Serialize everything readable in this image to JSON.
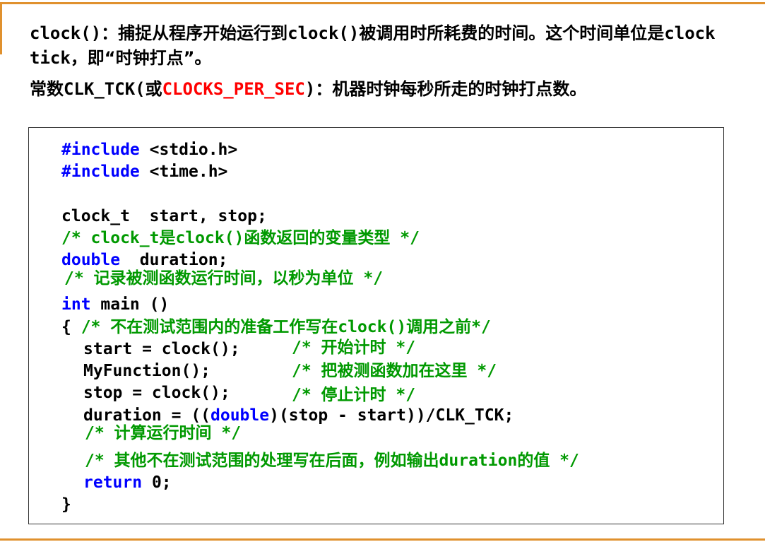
{
  "intro": {
    "line1_code": "clock()",
    "line1_text": "：捕捉从程序开始运行到",
    "line1_code2": "clock()",
    "line1_text2": "被调用时所耗费的时间。这个时间单位是",
    "line1_code3": "clock tick",
    "line1_text3": "，即“时钟打点”。",
    "line2_prefix": "常数",
    "line2_code": "CLK_TCK(",
    "line2_or": "或",
    "line2_red": "CLOCKS_PER_SEC",
    "line2_close": ")",
    "line2_text": "：机器时钟每秒所走的时钟打点数。"
  },
  "code": {
    "inc1_kw": "#include",
    "inc1_rest": " <stdio.h>",
    "inc2_kw": "#include",
    "inc2_rest": " <time.h>",
    "decl1": "clock_t  start, stop;",
    "cm1": "/* clock_t是clock()函数返回的变量类型 */",
    "decl2_kw": "double",
    "decl2_rest": "  duration;",
    "cm2": "/* 记录被测函数运行时间，以秒为单位 */",
    "main_kw": "int",
    "main_rest": " main ()",
    "brace_open": "{",
    "cm3": " /* 不在测试范围内的准备工作写在clock()调用之前*/",
    "s1": "start = clock();",
    "cm4": "/* 开始计时 */",
    "s2": "MyFunction();",
    "cm5": "/* 把被测函数加在这里 */",
    "s3": "stop = clock();",
    "cm6": "/* 停止计时 */",
    "s4_a": "duration = ((",
    "s4_kw": "double",
    "s4_b": ")(stop - start))/CLK_TCK;",
    "cm7": "/* 计算运行时间 */",
    "cm8": "/* 其他不在测试范围的处理写在后面，例如输出duration的值 */",
    "ret_kw": "return",
    "ret_rest": " 0;",
    "brace_close": "}"
  },
  "colors": {
    "accent": "#e0912e",
    "keyword": "#0000ff",
    "comment": "#009900",
    "highlight": "#ff0000"
  }
}
